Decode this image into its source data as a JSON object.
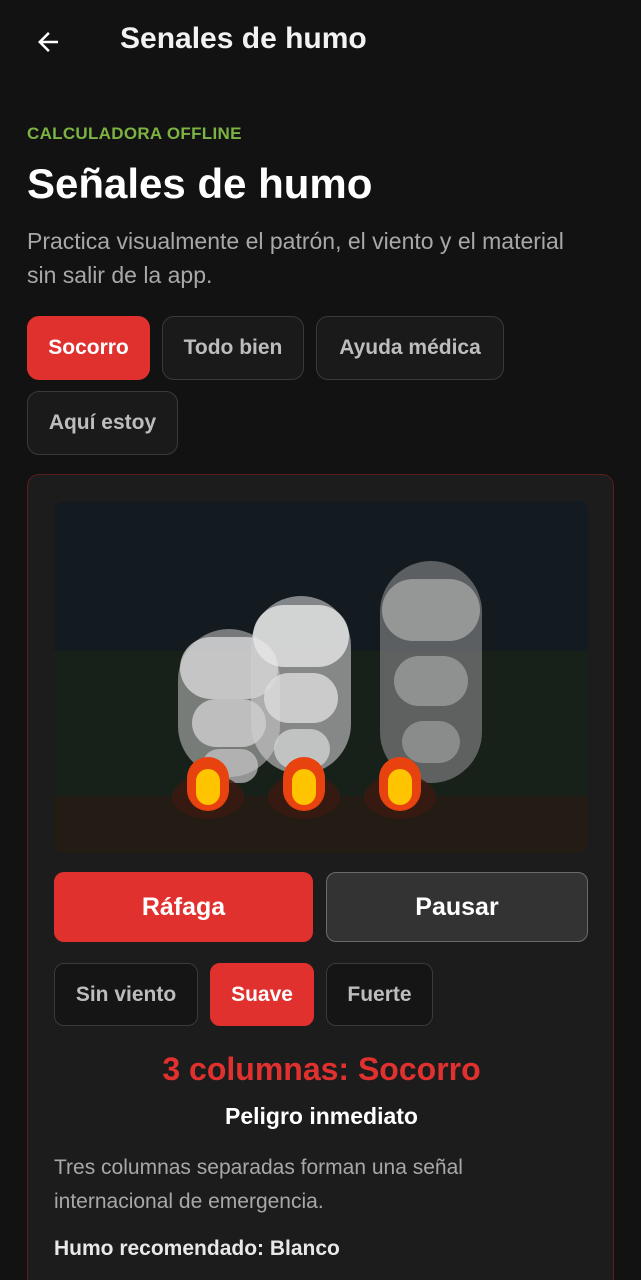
{
  "topbar": {
    "title": "Senales de humo",
    "back_icon": "arrow-left-icon"
  },
  "header": {
    "eyebrow": "CALCULADORA OFFLINE",
    "title": "Señales de humo",
    "subtitle": "Practica visualmente el patrón, el viento y el material sin salir de la app."
  },
  "signals": [
    {
      "label": "Socorro",
      "active": true
    },
    {
      "label": "Todo bien",
      "active": false
    },
    {
      "label": "Ayuda médica",
      "active": false
    },
    {
      "label": "Aquí estoy",
      "active": false
    }
  ],
  "controls": {
    "burst_label": "Ráfaga",
    "pause_label": "Pausar"
  },
  "wind": [
    {
      "label": "Sin viento",
      "active": false
    },
    {
      "label": "Suave",
      "active": true
    },
    {
      "label": "Fuerte",
      "active": false
    }
  ],
  "result": {
    "title": "3 columnas: Socorro",
    "subtitle": "Peligro inmediato",
    "description": "Tres columnas separadas forman una señal internacional de emergencia.",
    "smoke": "Humo recomendado: Blanco"
  },
  "colors": {
    "accent": "#e0312f",
    "eyebrow": "#7cb342",
    "background": "#121212"
  }
}
